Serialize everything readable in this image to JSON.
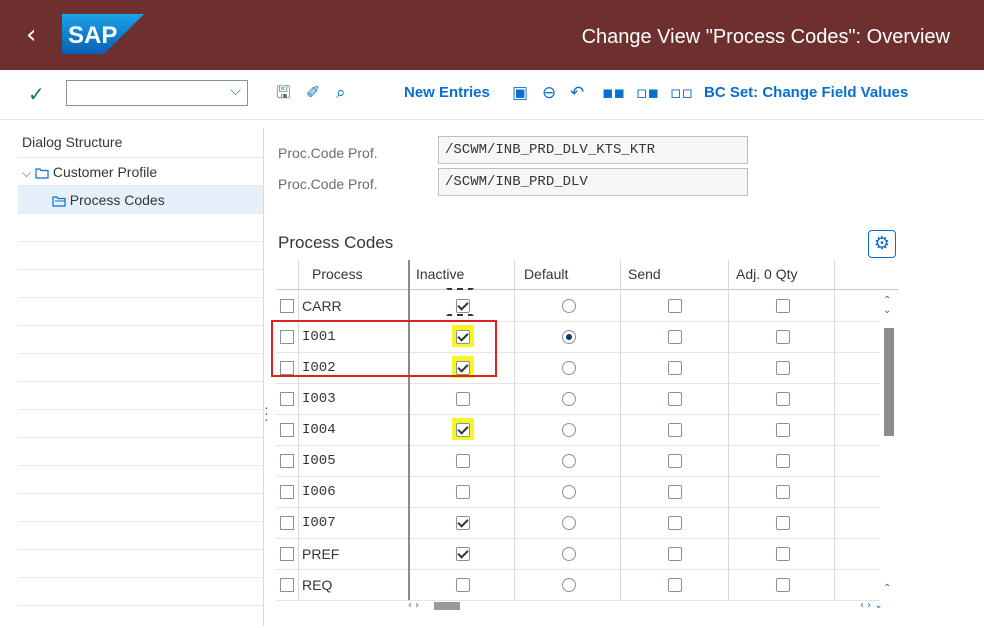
{
  "header": {
    "back_icon": "chevron-left-icon",
    "logo_text": "SAP",
    "title": "Change View \"Process Codes\": Overview",
    "brand_color": "#6e2f2f"
  },
  "toolbar": {
    "command_field_value": "",
    "new_entries_label": "New Entries",
    "bc_set_label": "BC Set: Change Field Values"
  },
  "dialog_structure": {
    "heading": "Dialog Structure",
    "items": [
      {
        "label": "Customer Profile",
        "level": 0,
        "expanded": true
      },
      {
        "label": "Process Codes",
        "level": 1,
        "selected": true
      }
    ]
  },
  "header_fields": [
    {
      "label": "Proc.Code Prof.",
      "value": "/SCWM/INB_PRD_DLV_KTS_KTR"
    },
    {
      "label": "Proc.Code Prof.",
      "value": "/SCWM/INB_PRD_DLV"
    }
  ],
  "table": {
    "title": "Process Codes",
    "columns": [
      "Process",
      "Inactive",
      "Default",
      "Send",
      "Adj. 0 Qty"
    ],
    "rows": [
      {
        "process": "CARR",
        "inactive": true,
        "default": false,
        "send": false,
        "adj": false,
        "highlight": false
      },
      {
        "process": "I001",
        "inactive": true,
        "default": true,
        "send": false,
        "adj": false,
        "highlight": true
      },
      {
        "process": "I002",
        "inactive": true,
        "default": false,
        "send": false,
        "adj": false,
        "highlight": true
      },
      {
        "process": "I003",
        "inactive": false,
        "default": false,
        "send": false,
        "adj": false,
        "highlight": false
      },
      {
        "process": "I004",
        "inactive": true,
        "default": false,
        "send": false,
        "adj": false,
        "highlight": true
      },
      {
        "process": "I005",
        "inactive": false,
        "default": false,
        "send": false,
        "adj": false,
        "highlight": false
      },
      {
        "process": "I006",
        "inactive": false,
        "default": false,
        "send": false,
        "adj": false,
        "highlight": false
      },
      {
        "process": "I007",
        "inactive": true,
        "default": false,
        "send": false,
        "adj": false,
        "highlight": false
      },
      {
        "process": "PREF",
        "inactive": true,
        "default": false,
        "send": false,
        "adj": false,
        "highlight": false
      },
      {
        "process": "REQ",
        "inactive": false,
        "default": false,
        "send": false,
        "adj": false,
        "highlight": false
      }
    ]
  },
  "annotation_color": "#e0201b",
  "highlight_color": "#f5f400"
}
